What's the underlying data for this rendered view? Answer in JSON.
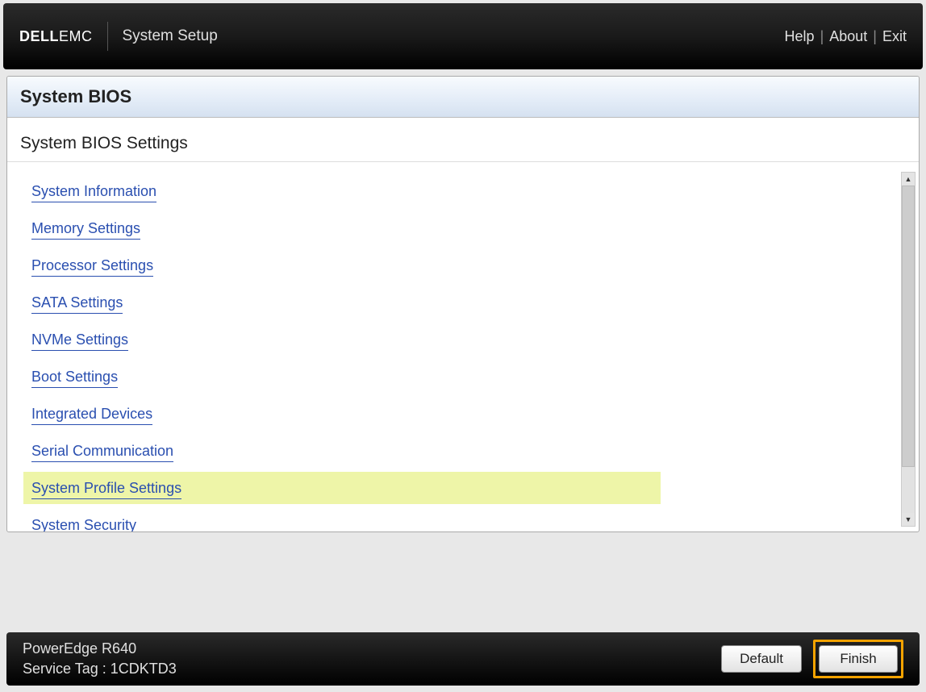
{
  "header": {
    "logo_bold": "DELL",
    "logo_light": "EMC",
    "title": "System Setup",
    "links": {
      "help": "Help",
      "about": "About",
      "exit": "Exit"
    }
  },
  "panel": {
    "title": "System BIOS",
    "subtitle": "System BIOS Settings"
  },
  "menu": {
    "items": [
      {
        "label": "System Information",
        "highlighted": false
      },
      {
        "label": "Memory Settings",
        "highlighted": false
      },
      {
        "label": "Processor Settings",
        "highlighted": false
      },
      {
        "label": "SATA Settings",
        "highlighted": false
      },
      {
        "label": "NVMe Settings",
        "highlighted": false
      },
      {
        "label": "Boot Settings",
        "highlighted": false
      },
      {
        "label": "Integrated Devices",
        "highlighted": false
      },
      {
        "label": "Serial Communication",
        "highlighted": false
      },
      {
        "label": "System Profile Settings",
        "highlighted": true
      },
      {
        "label": "System Security",
        "highlighted": false
      }
    ]
  },
  "footer": {
    "model": "PowerEdge R640",
    "service_tag_label": "Service Tag :",
    "service_tag_value": "1CDKTD3",
    "buttons": {
      "default": "Default",
      "finish": "Finish"
    }
  }
}
